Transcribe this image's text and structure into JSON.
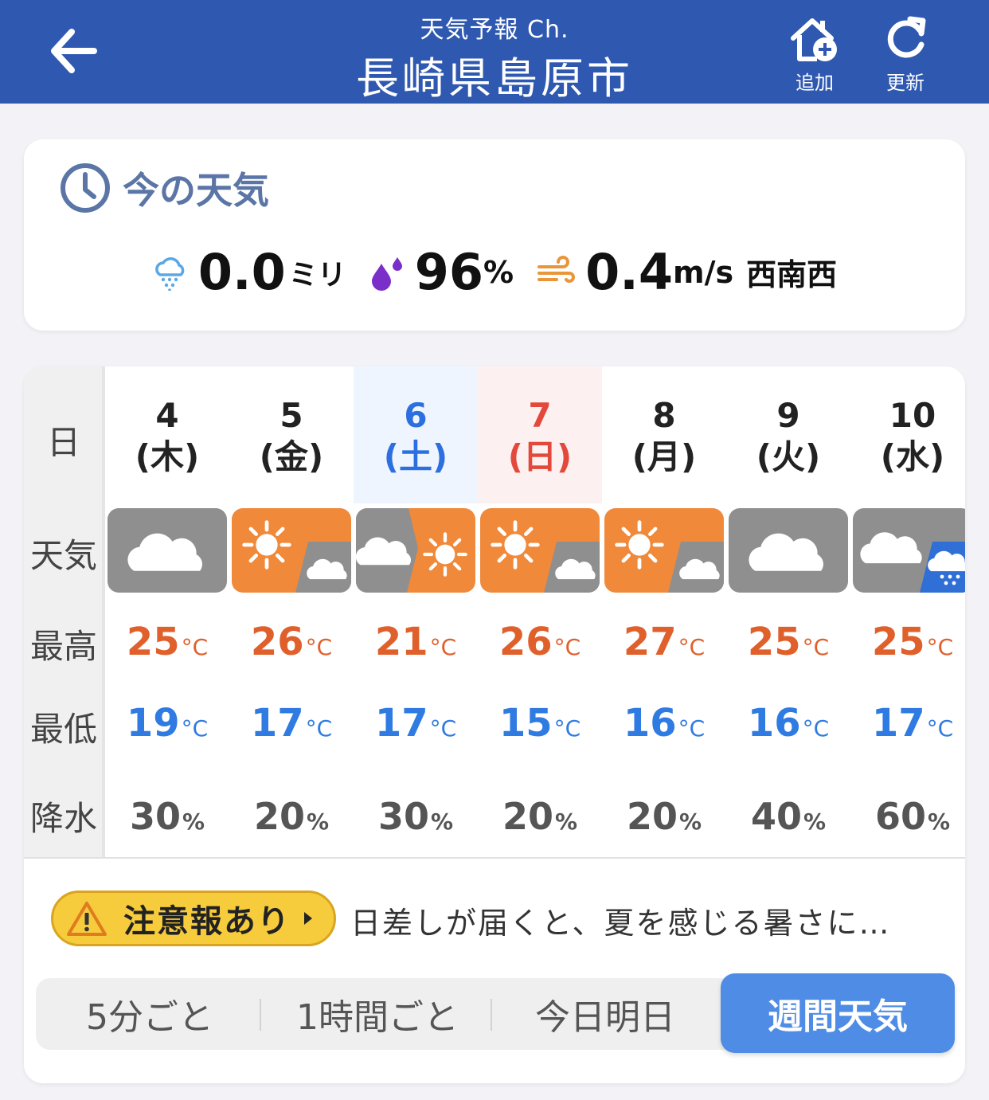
{
  "header": {
    "subtitle": "天気予報 Ch.",
    "title": "長崎県島原市",
    "add_label": "追加",
    "reload_label": "更新"
  },
  "now": {
    "title": "今の天気",
    "rain_value": "0.0",
    "rain_unit": "ミリ",
    "humidity_value": "96",
    "humidity_unit": "%",
    "wind_value": "0.4",
    "wind_unit": "m/s",
    "wind_dir": "西南西"
  },
  "week": {
    "row_labels": {
      "day": "日",
      "weather": "天気",
      "high": "最高",
      "low": "最低",
      "precip": "降水"
    },
    "temp_unit": "°C",
    "precip_unit": "%",
    "days": [
      {
        "date": "4",
        "dow": "(木)",
        "icon": "cloudy",
        "high": "25",
        "low": "19",
        "precip": "30"
      },
      {
        "date": "5",
        "dow": "(金)",
        "icon": "sunny-then-cloudy",
        "high": "26",
        "low": "17",
        "precip": "20"
      },
      {
        "date": "6",
        "dow": "(土)",
        "icon": "cloudy-then-sunny",
        "high": "21",
        "low": "17",
        "precip": "30"
      },
      {
        "date": "7",
        "dow": "(日)",
        "icon": "sunny-then-cloudy",
        "high": "26",
        "low": "15",
        "precip": "20"
      },
      {
        "date": "8",
        "dow": "(月)",
        "icon": "sunny-then-cloudy",
        "high": "27",
        "low": "16",
        "precip": "20"
      },
      {
        "date": "9",
        "dow": "(火)",
        "icon": "cloudy",
        "high": "25",
        "low": "16",
        "precip": "40"
      },
      {
        "date": "10",
        "dow": "(水)",
        "icon": "cloudy-then-rain",
        "high": "25",
        "low": "17",
        "precip": "60"
      }
    ]
  },
  "alert": {
    "badge": "注意報あり",
    "text": "日差しが届くと、夏を感じる暑さに…"
  },
  "tabs": {
    "items": [
      "5分ごと",
      "1時間ごと",
      "今日明日",
      "週間天気"
    ],
    "active": "週間天気"
  },
  "colors": {
    "header": "#2f58b0",
    "high_temp": "#e0602c",
    "low_temp": "#2f7be2",
    "saturday": "#2c6fe0",
    "sunday": "#e2493b",
    "sun_bg": "#f0893a",
    "cloud_bg": "#8f8f8f",
    "rain_bg": "#2f6fd6",
    "active_tab": "#4e8ce6"
  }
}
